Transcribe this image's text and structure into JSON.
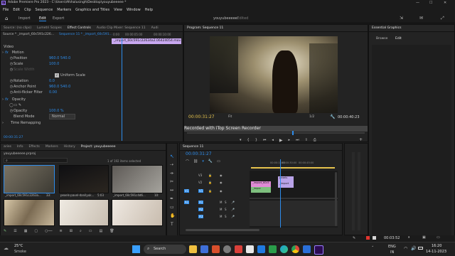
{
  "titlebar": {
    "title": "Adobe Premiere Pro 2023 - C:\\Users\\Afshalusingh\\Desktop\\youyubeeeee *",
    "minimize": "—",
    "maximize": "☐",
    "close": "✕"
  },
  "menu": [
    "File",
    "Edit",
    "Clip",
    "Sequence",
    "Markers",
    "Graphics and Titles",
    "View",
    "Window",
    "Help"
  ],
  "workspace": {
    "home": "⌂",
    "tabs": [
      "Import",
      "Edit",
      "Export"
    ],
    "project_name": "youyubeeeee",
    "project_status": "- Edited"
  },
  "source_panel": {
    "tabs": [
      "Source: (no clips)",
      "Lumetri Scopes",
      "Effect Controls",
      "Audio Clip Mixer: Sequence 11",
      "Audi"
    ],
    "header_source": "Source * _import_60c591c226...",
    "header_seq": "Sequence 11 * _import_60c591...",
    "clip_label": "_import_60c591c22634a2.06424054.mov",
    "ruler": [
      "0:00",
      "00:00:05:00",
      "00:00:10:00"
    ],
    "video_label": "Video",
    "motion": "Motion",
    "position_label": "Position",
    "position_x": "960.0",
    "position_y": "540.0",
    "scale_label": "Scale",
    "scale_value": "100.0",
    "scale_width_label": "Scale Width",
    "uniform_label": "Uniform Scale",
    "rotation_label": "Rotation",
    "rotation_value": "0.0",
    "anchor_label": "Anchor Point",
    "anchor_x": "960.0",
    "anchor_y": "540.0",
    "flicker_label": "Anti-flicker Filter",
    "flicker_value": "0.00",
    "opacity_group": "Opacity",
    "opacity_label": "Opacity",
    "opacity_value": "100.0 %",
    "blend_label": "Blend Mode",
    "blend_value": "Normal",
    "time_remap": "Time Remapping",
    "timecode": "00:00:31:27"
  },
  "program": {
    "title": "Program: Sequence 11",
    "timecode": "00:00:31:27",
    "fit": "Fit",
    "resolution": "1/2",
    "duration": "00:00:40:23",
    "watermark": "Recorded with iTop Screen Recorder"
  },
  "essential": {
    "title": "Essential Graphics",
    "tabs": [
      "Browse",
      "Edit"
    ]
  },
  "project_panel": {
    "tabs": [
      "aries",
      "Info",
      "Effects",
      "Markers",
      "History",
      "Project: youyubeeeee"
    ],
    "file": "youyubeeeee.prproj",
    "count": "1 of 192 items selected",
    "thumbs": [
      {
        "name": "_import_60c591c2263a...",
        "dur": "33:"
      },
      {
        "name": "pexels-pavel-danilyuk...",
        "dur": "5:03"
      },
      {
        "name": "_import_60c591c4d6...",
        "dur": "10:"
      },
      {
        "name": "",
        "dur": ""
      },
      {
        "name": "",
        "dur": ""
      },
      {
        "name": "",
        "dur": ""
      }
    ]
  },
  "timeline": {
    "title": "Sequence 11",
    "timecode": "00:00:31:27",
    "ruler": [
      "00:00:15:00",
      "00:00:30:00",
      "00:00:45:00"
    ],
    "tracks_video": [
      "V3",
      "V2",
      "V1"
    ],
    "tracks_audio": [
      "A1",
      "A2",
      "A3"
    ],
    "src_v": "V1",
    "src_a": "A1",
    "clips": [
      {
        "label": "_import_60c5",
        "track": "V1"
      },
      {
        "label": "_impor",
        "track": "V1"
      },
      {
        "label": "pexels",
        "track": "V2"
      },
      {
        "label": "_import",
        "track": "V2"
      }
    ]
  },
  "status": {
    "time": "00:03:52"
  },
  "taskbar": {
    "weather_temp": "25°C",
    "weather_desc": "Smoke",
    "search": "Search",
    "lang": "ENG",
    "region": "IN",
    "clock": "16:20",
    "date": "14-11-2023"
  },
  "colors": {
    "accent": "#2d8ceb",
    "clip_pink": "#e08ad6",
    "clip_green": "#7ec07e",
    "clip_purple": "#b9a3e8"
  }
}
